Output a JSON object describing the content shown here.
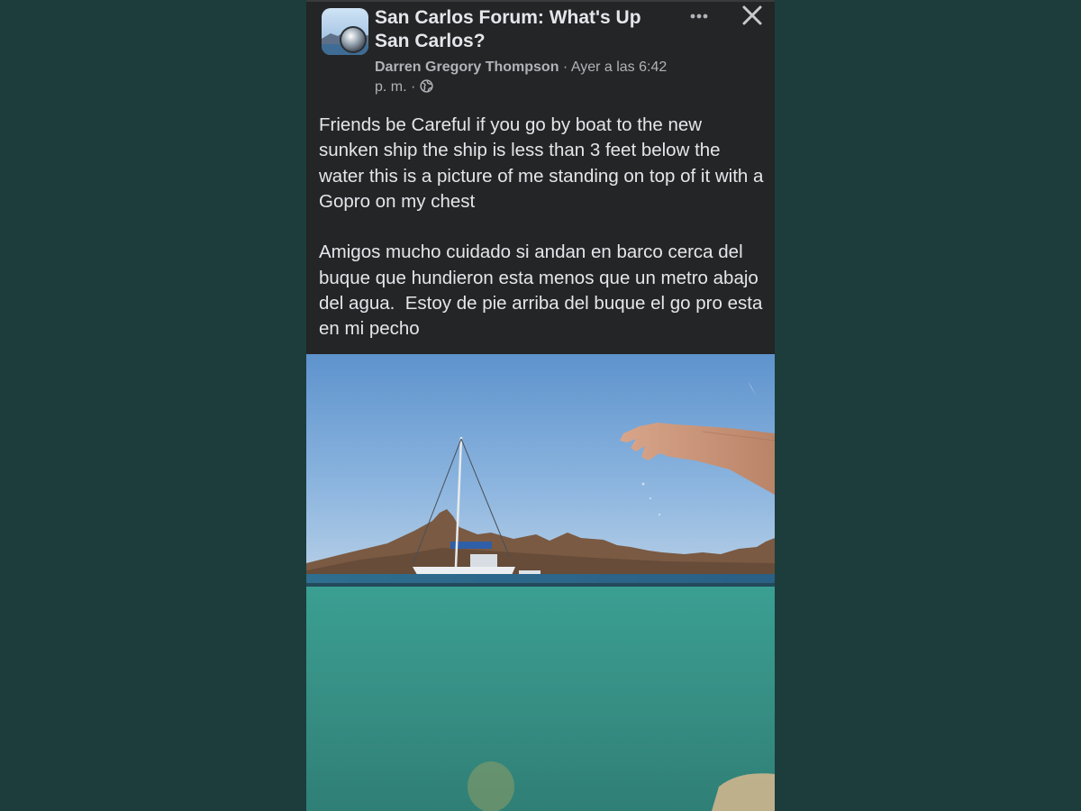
{
  "post": {
    "group_name": "San Carlos Forum: What's Up San Carlos?",
    "author": "Darren Gregory Thompson",
    "separator": " · ",
    "time": "Ayer a las 6:42 p. m.",
    "time_separator": " · ",
    "privacy_icon": "globe-icon",
    "body": "Friends be Careful if you go by boat to the new sunken ship the ship is less than 3 feet below the water this is a picture of me standing on top of it with a Gopro on my chest\n\nAmigos mucho cuidado si andan en barco cerca del buque que hundieron esta menos que un metro abajo del agua.  Estoy de pie arriba del buque el go pro esta en mi pecho"
  },
  "header": {
    "more_icon": "more-options-icon",
    "close_icon": "close-icon"
  },
  "colors": {
    "background": "#1c3d3c",
    "card": "#242526",
    "text_primary": "#e4e6eb",
    "text_secondary": "#b0b3b8",
    "water": "#3a9e92",
    "sky": "#6f9fd0"
  }
}
